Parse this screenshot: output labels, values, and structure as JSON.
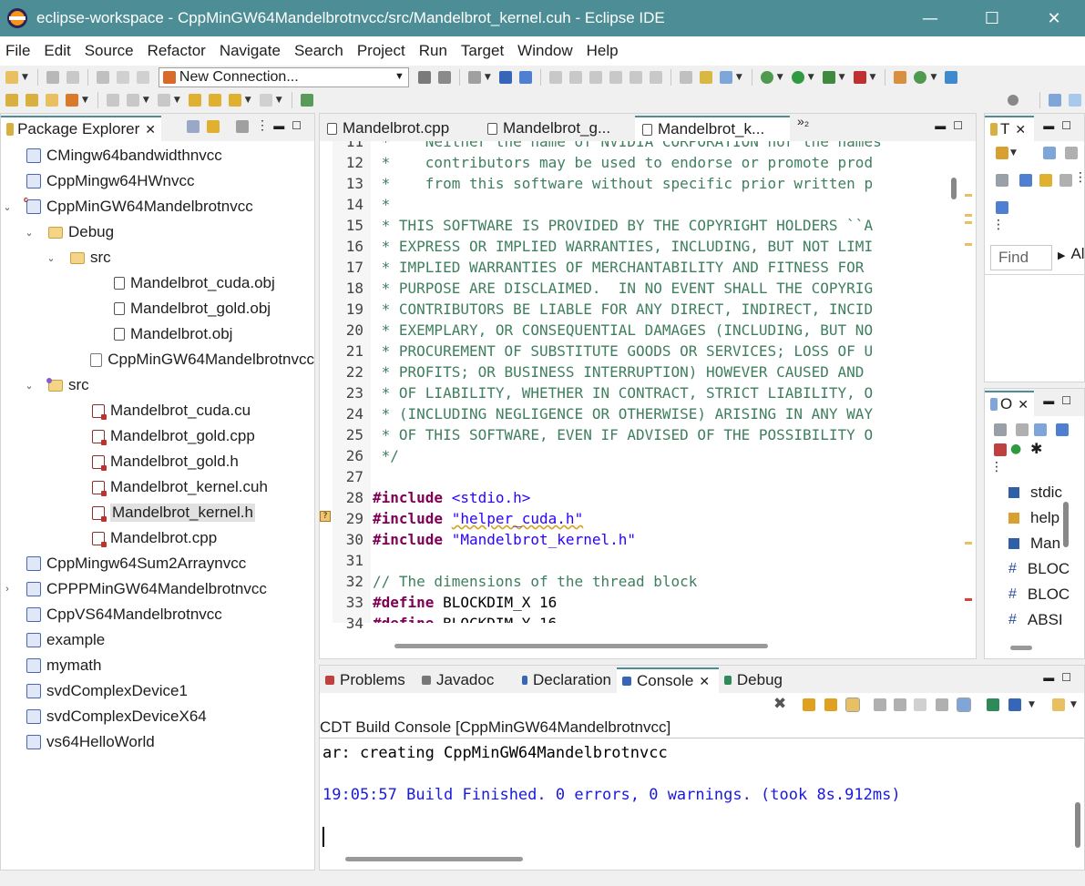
{
  "window": {
    "title": "eclipse-workspace - CppMinGW64Mandelbrotnvcc/src/Mandelbrot_kernel.cuh - Eclipse IDE",
    "minimize": "—",
    "maximize": "☐",
    "close": "✕"
  },
  "menu": [
    "File",
    "Edit",
    "Source",
    "Refactor",
    "Navigate",
    "Search",
    "Project",
    "Run",
    "Target",
    "Window",
    "Help"
  ],
  "toolbar": {
    "connection_combo": "New Connection..."
  },
  "package_explorer": {
    "tab_label": "Package Explorer",
    "items": [
      {
        "label": "CMingw64bandwidthnvcc",
        "icon": "project-icon",
        "indent": 0,
        "twisty": ""
      },
      {
        "label": "CppMingw64HWnvcc",
        "icon": "project-icon",
        "indent": 0,
        "twisty": ""
      },
      {
        "label": "CppMinGW64Mandelbrotnvcc",
        "icon": "c-project-icon",
        "indent": 0,
        "twisty": "⌄"
      },
      {
        "label": "Debug",
        "icon": "folder-icon",
        "indent": 1,
        "twisty": "⌄"
      },
      {
        "label": "src",
        "icon": "folder-icon",
        "indent": 2,
        "twisty": "⌄"
      },
      {
        "label": "Mandelbrot_cuda.obj",
        "icon": "object-file-icon",
        "indent": 4,
        "twisty": ""
      },
      {
        "label": "Mandelbrot_gold.obj",
        "icon": "object-file-icon",
        "indent": 4,
        "twisty": ""
      },
      {
        "label": "Mandelbrot.obj",
        "icon": "object-file-icon",
        "indent": 4,
        "twisty": ""
      },
      {
        "label": "CppMinGW64Mandelbrotnvcc",
        "icon": "binary-file-icon",
        "indent": 3,
        "twisty": ""
      },
      {
        "label": "src",
        "icon": "source-folder-icon",
        "indent": 1,
        "twisty": "⌄"
      },
      {
        "label": "Mandelbrot_cuda.cu",
        "icon": "c-file-icon",
        "indent": 3,
        "twisty": ""
      },
      {
        "label": "Mandelbrot_gold.cpp",
        "icon": "c-file-icon",
        "indent": 3,
        "twisty": ""
      },
      {
        "label": "Mandelbrot_gold.h",
        "icon": "c-file-icon",
        "indent": 3,
        "twisty": ""
      },
      {
        "label": "Mandelbrot_kernel.cuh",
        "icon": "c-file-icon",
        "indent": 3,
        "twisty": ""
      },
      {
        "label": "Mandelbrot_kernel.h",
        "icon": "c-file-icon",
        "indent": 3,
        "twisty": "",
        "selected": true
      },
      {
        "label": "Mandelbrot.cpp",
        "icon": "c-file-icon",
        "indent": 3,
        "twisty": ""
      },
      {
        "label": "CppMingw64Sum2Arraynvcc",
        "icon": "project-icon",
        "indent": 0,
        "twisty": ""
      },
      {
        "label": "CPPPMinGW64Mandelbrotnvcc",
        "icon": "project-icon",
        "indent": 0,
        "twisty": "›"
      },
      {
        "label": "CppVS64Mandelbrotnvcc",
        "icon": "project-icon",
        "indent": 0,
        "twisty": ""
      },
      {
        "label": "example",
        "icon": "project-icon",
        "indent": 0,
        "twisty": ""
      },
      {
        "label": "mymath",
        "icon": "project-icon",
        "indent": 0,
        "twisty": ""
      },
      {
        "label": "svdComplexDevice1",
        "icon": "project-icon",
        "indent": 0,
        "twisty": ""
      },
      {
        "label": "svdComplexDeviceX64",
        "icon": "project-icon",
        "indent": 0,
        "twisty": ""
      },
      {
        "label": "vs64HelloWorld",
        "icon": "project-icon",
        "indent": 0,
        "twisty": ""
      }
    ]
  },
  "editor": {
    "tabs": [
      {
        "label": "Mandelbrot.cpp",
        "active": false
      },
      {
        "label": "Mandelbrot_g...",
        "active": false
      },
      {
        "label": "Mandelbrot_k...",
        "active": true
      }
    ],
    "overflow": "»₂",
    "lines": [
      {
        "n": "11",
        "parts": [
          {
            "c": "cmt",
            "t": " *    Neither the name of NVIDIA CORPORATION nor the names"
          }
        ]
      },
      {
        "n": "12",
        "parts": [
          {
            "c": "cmt",
            "t": " *    contributors may be used to endorse or promote prod"
          }
        ]
      },
      {
        "n": "13",
        "parts": [
          {
            "c": "cmt",
            "t": " *    from this software without specific prior written p"
          }
        ]
      },
      {
        "n": "14",
        "parts": [
          {
            "c": "cmt",
            "t": " *"
          }
        ]
      },
      {
        "n": "15",
        "parts": [
          {
            "c": "cmt",
            "t": " * THIS SOFTWARE IS PROVIDED BY THE COPYRIGHT HOLDERS ``A"
          }
        ]
      },
      {
        "n": "16",
        "parts": [
          {
            "c": "cmt",
            "t": " * EXPRESS OR IMPLIED WARRANTIES, INCLUDING, BUT NOT LIMI"
          }
        ]
      },
      {
        "n": "17",
        "parts": [
          {
            "c": "cmt",
            "t": " * IMPLIED WARRANTIES OF MERCHANTABILITY AND FITNESS FOR"
          }
        ]
      },
      {
        "n": "18",
        "parts": [
          {
            "c": "cmt",
            "t": " * PURPOSE ARE DISCLAIMED.  IN NO EVENT SHALL THE COPYRIG"
          }
        ]
      },
      {
        "n": "19",
        "parts": [
          {
            "c": "cmt",
            "t": " * CONTRIBUTORS BE LIABLE FOR ANY DIRECT, INDIRECT, INCID"
          }
        ]
      },
      {
        "n": "20",
        "parts": [
          {
            "c": "cmt",
            "t": " * EXEMPLARY, OR CONSEQUENTIAL DAMAGES (INCLUDING, BUT NO"
          }
        ]
      },
      {
        "n": "21",
        "parts": [
          {
            "c": "cmt",
            "t": " * PROCUREMENT OF SUBSTITUTE GOODS OR SERVICES; LOSS OF U"
          }
        ]
      },
      {
        "n": "22",
        "parts": [
          {
            "c": "cmt",
            "t": " * PROFITS; OR BUSINESS INTERRUPTION) HOWEVER CAUSED AND"
          }
        ]
      },
      {
        "n": "23",
        "parts": [
          {
            "c": "cmt",
            "t": " * OF LIABILITY, WHETHER IN CONTRACT, STRICT LIABILITY, O"
          }
        ]
      },
      {
        "n": "24",
        "parts": [
          {
            "c": "cmt",
            "t": " * (INCLUDING NEGLIGENCE OR OTHERWISE) ARISING IN ANY WAY"
          }
        ]
      },
      {
        "n": "25",
        "parts": [
          {
            "c": "cmt",
            "t": " * OF THIS SOFTWARE, EVEN IF ADVISED OF THE POSSIBILITY O"
          }
        ]
      },
      {
        "n": "26",
        "parts": [
          {
            "c": "cmt",
            "t": " */"
          }
        ]
      },
      {
        "n": "27",
        "parts": []
      },
      {
        "n": "28",
        "parts": [
          {
            "c": "kw",
            "t": "#include"
          },
          {
            "c": "txt",
            "t": " "
          },
          {
            "c": "str",
            "t": "<stdio.h>"
          }
        ]
      },
      {
        "n": "29",
        "parts": [
          {
            "c": "kw",
            "t": "#include"
          },
          {
            "c": "txt",
            "t": " "
          },
          {
            "c": "str",
            "t": "\"helper_cuda.h\""
          }
        ]
      },
      {
        "n": "30",
        "parts": [
          {
            "c": "kw",
            "t": "#include"
          },
          {
            "c": "txt",
            "t": " "
          },
          {
            "c": "str",
            "t": "\"Mandelbrot_kernel.h\""
          }
        ]
      },
      {
        "n": "31",
        "parts": []
      },
      {
        "n": "32",
        "parts": [
          {
            "c": "cmt",
            "t": "// The dimensions of the thread block"
          }
        ]
      },
      {
        "n": "33",
        "parts": [
          {
            "c": "kw",
            "t": "#define"
          },
          {
            "c": "txt",
            "t": " BLOCKDIM_X 16"
          }
        ]
      },
      {
        "n": "34",
        "parts": [
          {
            "c": "kw",
            "t": "#define"
          },
          {
            "c": "txt",
            "t": " BLOCKDIM_Y 16"
          }
        ]
      }
    ]
  },
  "type_hierarchy": {
    "tab_label": "T",
    "find_placeholder": "Find",
    "all_label": "Al"
  },
  "outline": {
    "tab_label": "O",
    "items": [
      {
        "label": "stdic",
        "icon": "include-icon"
      },
      {
        "label": "help",
        "icon": "include-warning-icon"
      },
      {
        "label": "Man",
        "icon": "include-icon"
      },
      {
        "label": "BLOC",
        "icon": "macro-icon"
      },
      {
        "label": "BLOC",
        "icon": "macro-icon"
      },
      {
        "label": "ABSI",
        "icon": "macro-icon"
      }
    ]
  },
  "bottom_panel": {
    "tabs": [
      {
        "label": "Problems",
        "active": false,
        "icon": "problems-icon"
      },
      {
        "label": "Javadoc",
        "active": false,
        "icon": "javadoc-icon"
      },
      {
        "label": "Declaration",
        "active": false,
        "icon": "declaration-icon"
      },
      {
        "label": "Console",
        "active": true,
        "icon": "console-icon"
      },
      {
        "label": "Debug",
        "active": false,
        "icon": "debug-icon"
      }
    ],
    "console_name": "CDT Build Console [CppMinGW64Mandelbrotnvcc]",
    "lines": [
      {
        "text": "ar: creating CppMinGW64Mandelbrotnvcc",
        "color": "#000000"
      },
      {
        "text": "19:05:57 Build Finished. 0 errors, 0 warnings. (took 8s.912ms)",
        "color": "#1a1adb"
      }
    ]
  },
  "colors": {
    "titlebar": "#4c8d96",
    "comment": "#3f7f5f",
    "keyword": "#7f0055",
    "string": "#2a00ff"
  }
}
